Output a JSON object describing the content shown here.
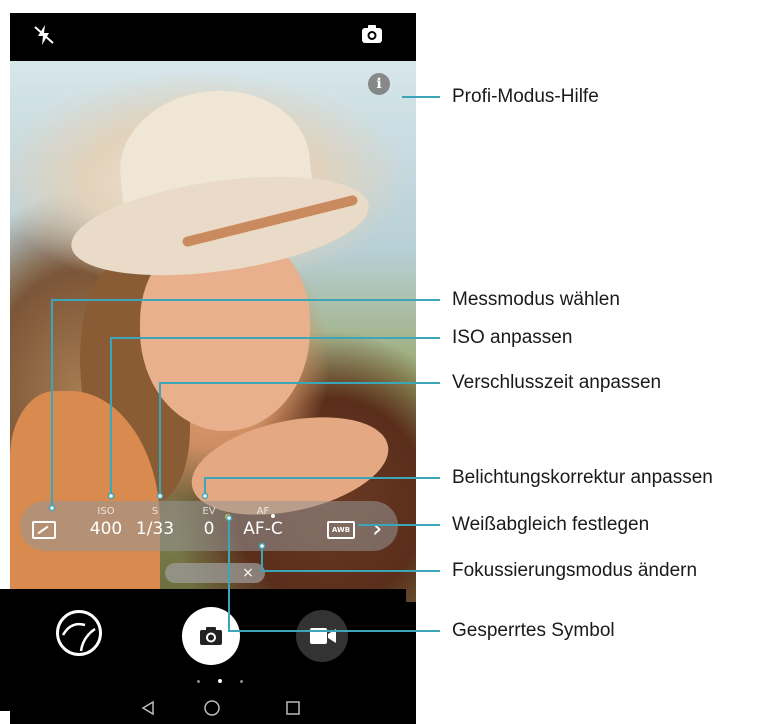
{
  "pro_bar": {
    "iso": {
      "label": "ISO",
      "value": "400"
    },
    "shutter": {
      "label": "S",
      "value": "1/33"
    },
    "ev": {
      "label": "EV",
      "value": "0"
    },
    "af": {
      "label": "AF",
      "value": "AF-C"
    },
    "awb_icon_text": "AWB"
  },
  "icons": {
    "flash": "flash-off-icon",
    "switch_camera": "switch-camera-icon",
    "info": "info-icon",
    "metering": "metering-mode-icon",
    "white_balance": "awb-icon",
    "more": "chevron-right-icon",
    "gallery": "gallery-thumbnail-icon",
    "shutter": "camera-icon",
    "video": "video-camera-icon",
    "back": "nav-back-icon",
    "home": "nav-home-icon",
    "recent": "nav-recent-icon"
  },
  "info_glyph": "i",
  "slider_close": "×",
  "annotations": {
    "help": "Profi-Modus-Hilfe",
    "metering": "Messmodus wählen",
    "iso": "ISO anpassen",
    "shutter": "Verschlusszeit anpassen",
    "ev": "Belichtungskorrektur anpassen",
    "awb": "Weißabgleich festlegen",
    "focus": "Fokussierungsmodus ändern",
    "lock": "Gesperrtes Symbol"
  },
  "colors": {
    "annotation_line": "#3aa6b8",
    "lock_indicator": "#f2c230"
  }
}
